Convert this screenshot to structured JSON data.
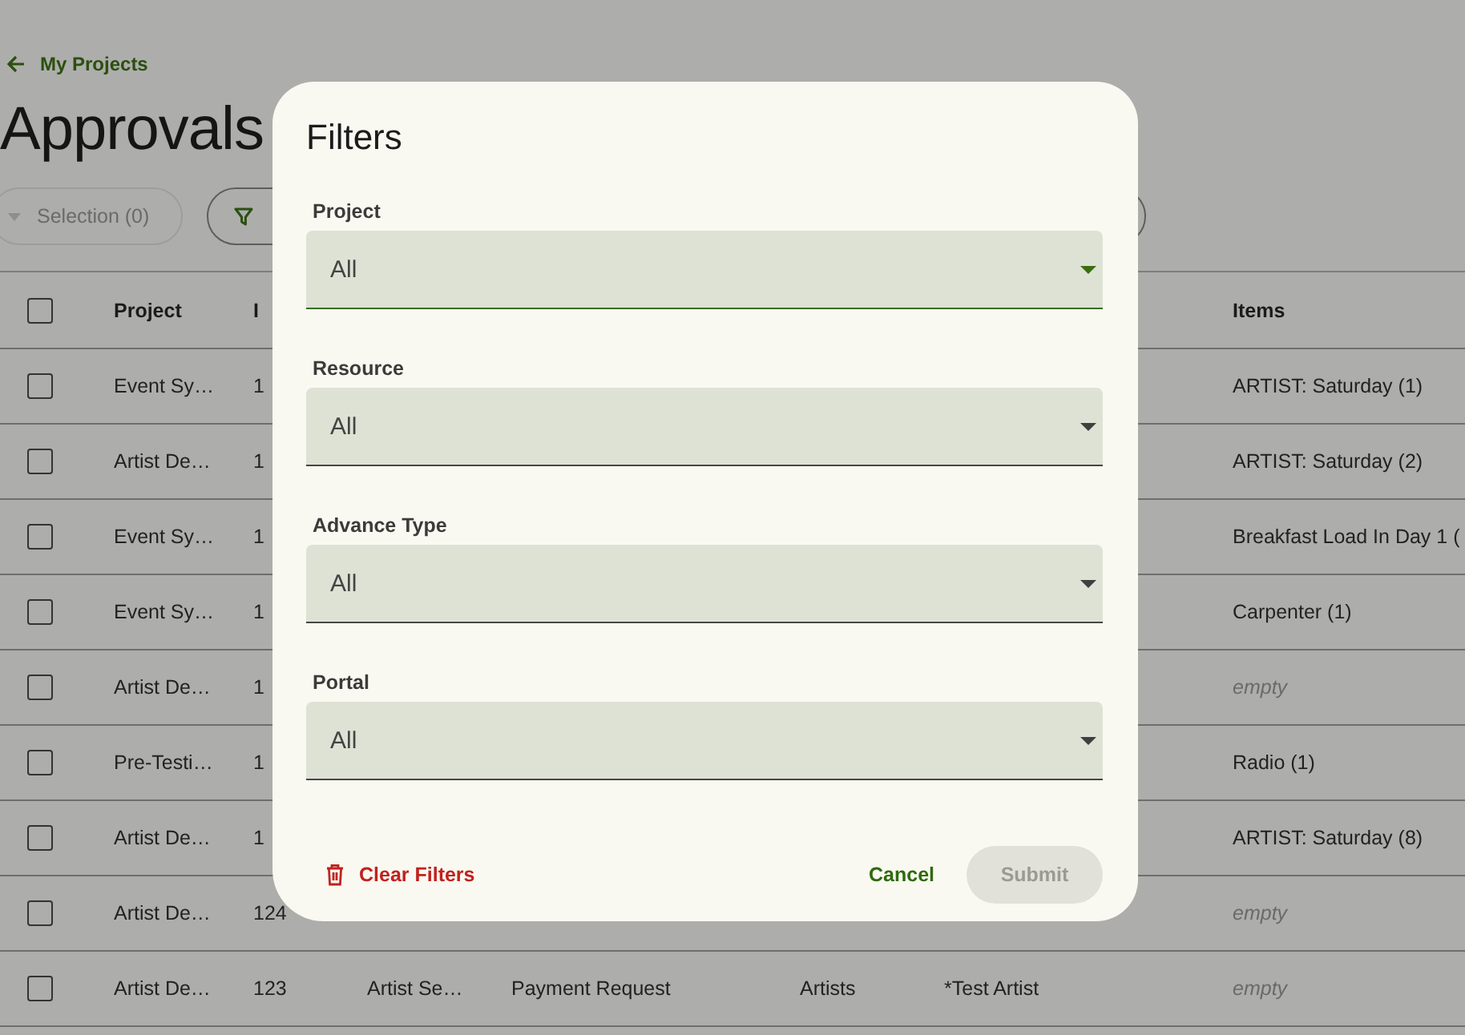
{
  "back_link": {
    "label": "My Projects"
  },
  "page_title": "Approvals",
  "toolbar": {
    "selection_button": {
      "label": "Selection (0)",
      "disabled": true
    }
  },
  "table": {
    "select_all": {
      "checked": false
    },
    "columns": [
      "Project",
      "I",
      "Items"
    ],
    "rows": [
      {
        "checked": false,
        "project": "Event Sy…",
        "id": "1",
        "items": {
          "text": "ARTIST: Saturday (1)",
          "placeholder": false
        }
      },
      {
        "checked": false,
        "project": "Artist De…",
        "id": "1",
        "items": {
          "text": "ARTIST: Saturday (2)",
          "placeholder": false
        }
      },
      {
        "checked": false,
        "project": "Event Sy…",
        "id": "1",
        "items": {
          "text": "Breakfast Load In Day 1 (",
          "placeholder": false
        }
      },
      {
        "checked": false,
        "project": "Event Sy…",
        "id": "1",
        "items": {
          "text": "Carpenter (1)",
          "placeholder": false
        }
      },
      {
        "checked": false,
        "project": "Artist De…",
        "id": "1",
        "items": {
          "text": "empty",
          "placeholder": true
        }
      },
      {
        "checked": false,
        "project": "Pre-Testi…",
        "id": "1",
        "items": {
          "text": "Radio (1)",
          "placeholder": false
        }
      },
      {
        "checked": false,
        "project": "Artist De…",
        "id": "1",
        "items": {
          "text": "ARTIST: Saturday (8)",
          "placeholder": false
        }
      },
      {
        "checked": false,
        "project": "Artist De…",
        "id": "124",
        "items": {
          "text": "empty",
          "placeholder": true
        }
      },
      {
        "checked": false,
        "project": "Artist De…",
        "id": "123",
        "column_3": "Artist Se…",
        "column_4": "Payment Request",
        "column_5": "Artists",
        "column_6": "*Test Artist",
        "items": {
          "text": "empty",
          "placeholder": true
        }
      }
    ]
  },
  "dialog": {
    "title": "Filters",
    "fields": [
      {
        "label": "Project",
        "value": "All",
        "focused": true
      },
      {
        "label": "Resource",
        "value": "All",
        "focused": false
      },
      {
        "label": "Advance Type",
        "value": "All",
        "focused": false
      },
      {
        "label": "Portal",
        "value": "All",
        "focused": false
      }
    ],
    "clear_button": "Clear Filters",
    "cancel_button": "Cancel",
    "submit_button": {
      "label": "Submit",
      "disabled": true
    }
  }
}
